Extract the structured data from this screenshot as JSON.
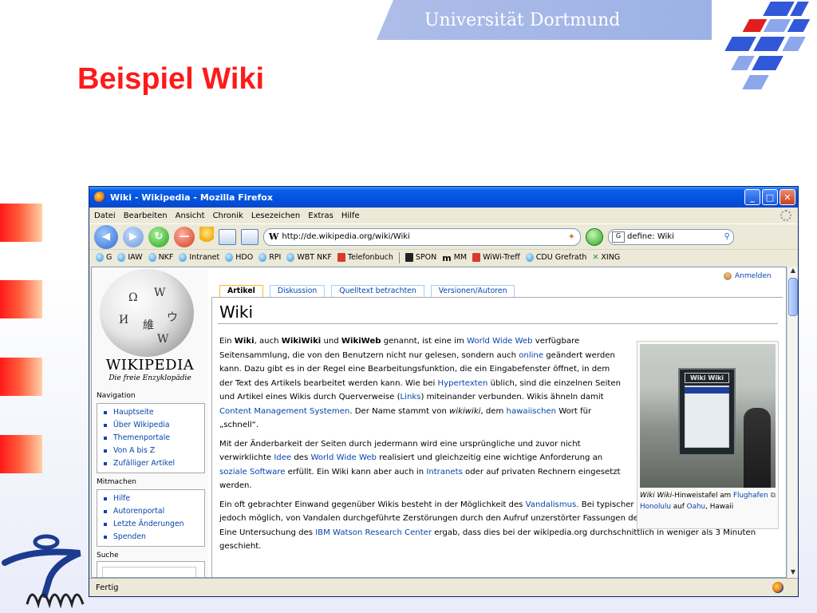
{
  "slide": {
    "university": "Universität Dortmund",
    "title": "Beispiel Wiki"
  },
  "window": {
    "title": "Wiki - Wikipedia - Mozilla Firefox",
    "controls": {
      "minimize": "_",
      "maximize": "□",
      "close": "✕"
    }
  },
  "menubar": [
    "Datei",
    "Bearbeiten",
    "Ansicht",
    "Chronik",
    "Lesezeichen",
    "Extras",
    "Hilfe"
  ],
  "navbar": {
    "url": "http://de.wikipedia.org/wiki/Wiki",
    "url_icon": "W",
    "search_value": "define: Wiki",
    "search_engine": "G"
  },
  "bookmarks": [
    "G",
    "IAW",
    "NKF",
    "Intranet",
    "HDO",
    "RPI",
    "WBT NKF",
    "Telefonbuch",
    "SPON",
    "MM",
    "WiWi-Treff",
    "CDU Grefrath",
    "XING"
  ],
  "bookmark_glyphs": {
    "mm": "m",
    "xing": "✕"
  },
  "status": {
    "text": "Fertig"
  },
  "wikipedia": {
    "wordmark": "WIKIPEDIA",
    "tagline": "Die freie Enzyklopädie",
    "globe_glyphs": [
      "Ω",
      "W",
      "И",
      "維",
      "ウ",
      "W"
    ],
    "login": "Anmelden",
    "tabs": [
      "Artikel",
      "Diskussion",
      "Quelltext betrachten",
      "Versionen/Autoren"
    ],
    "navigation": {
      "heading": "Navigation",
      "items": [
        "Hauptseite",
        "Über Wikipedia",
        "Themenportale",
        "Von A bis Z",
        "Zufälliger Artikel"
      ]
    },
    "mitmachen": {
      "heading": "Mitmachen",
      "items": [
        "Hilfe",
        "Autorenportal",
        "Letzte Änderungen",
        "Spenden"
      ]
    },
    "search_heading": "Suche",
    "page_title": "Wiki",
    "p1": {
      "s1": "Ein ",
      "b1": "Wiki",
      "s2": ", auch ",
      "b2": "WikiWiki",
      "s3": " und ",
      "b3": "WikiWeb",
      "s4": " genannt, ist eine im ",
      "l1": "World Wide Web",
      "s5": " verfügbare Seitensammlung, die von den Benutzern nicht nur gelesen, sondern auch ",
      "l2": "online",
      "s6": " geändert werden kann. Dazu gibt es in der Regel eine Bearbeitungsfunktion, die ein Eingabefenster öffnet, in dem der Text des Artikels bearbeitet werden kann. Wie bei ",
      "l3": "Hypertexten",
      "s7": " üblich, sind die einzelnen Seiten und Artikel eines Wikis durch Querverweise (",
      "l4": "Links",
      "s8": ") miteinander verbunden. Wikis ähneln damit ",
      "l5": "Content Management Systemen",
      "s9": ". Der Name stammt von ",
      "i1": "wikiwiki",
      "s10": ", dem ",
      "l6": "hawaiischen",
      "s11": " Wort für „schnell“."
    },
    "p2": {
      "s1": "Mit der Änderbarkeit der Seiten durch jedermann wird eine ursprüngliche und zuvor nicht verwirklichte ",
      "l1": "Idee",
      "s2": " des ",
      "l2": "World Wide Web",
      "s3": " realisiert und gleichzeitig eine wichtige Anforderung an ",
      "l3": "soziale Software",
      "s4": " erfüllt. Ein Wiki kann aber auch in ",
      "l4": "Intranets",
      "s5": " oder auf privaten Rechnern eingesetzt werden."
    },
    "p3": {
      "s1": "Ein oft gebrachter Einwand gegenüber Wikis besteht in der Möglichkeit des ",
      "l1": "Vandalismus",
      "s2": ". Bei typischer Wiki-Software ist es Benutzern jedoch möglich, von Vandalen durchgeführte Zerstörungen durch den Aufruf unzerstörter Fassungen der betroffenen Seiten zu beheben. Eine Untersuchung des ",
      "l2": "IBM Watson Research Center",
      "s3": " ergab, dass dies bei der wikipedia.org durchschnittlich in weniger als 3 Minuten geschieht."
    },
    "thumb": {
      "sign_text": "Wiki Wiki",
      "caption_italic": "Wiki Wiki",
      "caption_s1": "-Hinweistafel am ",
      "caption_l1": "Flughafen Honolulu",
      "caption_s2": " auf ",
      "caption_l2": "Oahu",
      "caption_s3": ", Hawaii"
    }
  },
  "colors": {
    "slide_title": "#ff1a1a",
    "banner": "#a7b8e8",
    "link": "#0645ad",
    "xp_titlebar": "#0052e0"
  },
  "icons": [
    "back-arrow-icon",
    "forward-arrow-icon",
    "reload-icon",
    "stop-icon",
    "home-icon",
    "globe-icon",
    "user-icon",
    "magnify-icon",
    "firefox-icon"
  ]
}
